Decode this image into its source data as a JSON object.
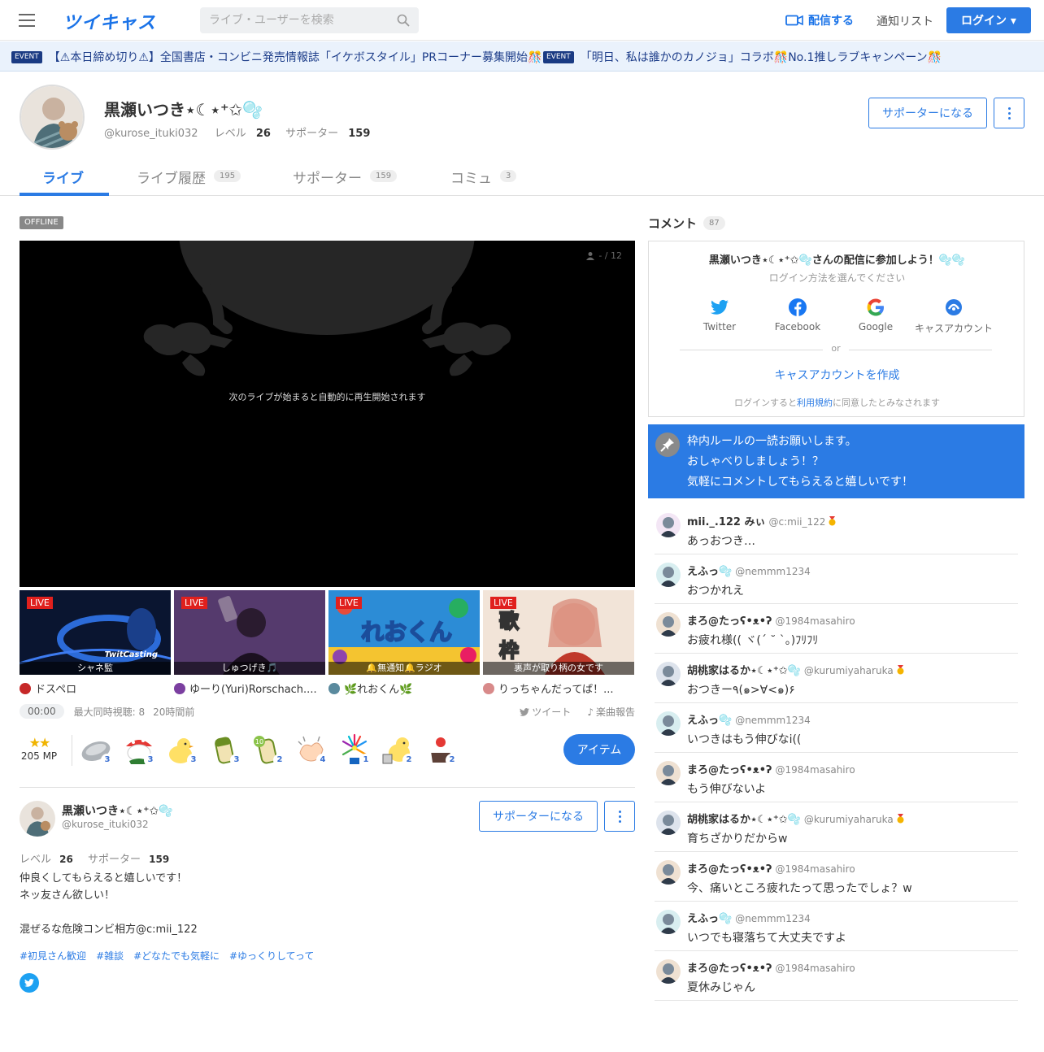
{
  "header": {
    "logo": "ツイキャス",
    "search_placeholder": "ライブ・ユーザーを検索",
    "stream_label": "配信する",
    "notif_label": "通知リスト",
    "login_label": "ログイン ▾"
  },
  "banner": {
    "events": [
      {
        "badge": "EVENT",
        "text": "【⚠本日締め切り⚠】全国書店・コンビニ発売情報誌「イケボスタイル」PRコーナー募集開始🎊"
      },
      {
        "badge": "EVENT",
        "text": "「明日、私は誰かのカノジョ」コラボ🎊No.1推しラブキャンペーン🎊"
      }
    ]
  },
  "profile": {
    "name": "黒瀬いつき⋆☾⋆⁺✩🫧",
    "handle": "@kurose_ituki032",
    "level_label": "レベル",
    "level": "26",
    "supporter_label": "サポーター",
    "supporters": "159",
    "support_button": "サポーターになる"
  },
  "tabs": [
    {
      "label": "ライブ",
      "count": ""
    },
    {
      "label": "ライブ履歴",
      "count": "195"
    },
    {
      "label": "サポーター",
      "count": "159"
    },
    {
      "label": "コミュ",
      "count": "3"
    }
  ],
  "player": {
    "status": "OFFLINE",
    "viewers": "- / 12",
    "autoplay_msg": "次のライブが始まると自動的に再生開始されます"
  },
  "recommended": [
    {
      "live": "LIVE",
      "caption": "シャネ監",
      "name": "ドスペロ",
      "thumb_text": "TwitCasting",
      "color": "#c62828"
    },
    {
      "live": "LIVE",
      "caption": "しゅつげき🎵",
      "name": "ゆーり(Yuri)Rorschach....",
      "thumb_text": "",
      "color": "#7b3fa0"
    },
    {
      "live": "LIVE",
      "caption": "🔔無通知🔔ラジオ",
      "name": "🌿れおくん🌿",
      "thumb_text": "れおくん",
      "color": "#5a8a9e"
    },
    {
      "live": "LIVE",
      "caption": "裏声が取り柄の女です",
      "name": "りっちゃんだってば！...",
      "thumb_text": "歌枠",
      "color": "#d88a8a"
    }
  ],
  "meta": {
    "time": "00:00",
    "max_viewers": "最大同時視聴: 8",
    "ago": "20時間前",
    "tweet": "ツイート",
    "song_report": "楽曲報告"
  },
  "items": {
    "stars": "★★",
    "mp": "205 MP",
    "counts": [
      "3",
      "3",
      "3",
      "3",
      "2",
      "4",
      "1",
      "2",
      "2"
    ],
    "button": "アイテム"
  },
  "bio": {
    "level_label": "レベル",
    "level": "26",
    "supporter_label": "サポーター",
    "supporters": "159",
    "text": "仲良くしてもらえると嬉しいです！\nネッ友さん欲しい！\n\n混ぜるな危険コンビ相方@c:mii_122",
    "tags": [
      "#初見さん歓迎",
      "#雑談",
      "#どなたでも気軽に",
      "#ゆっくりしてって"
    ]
  },
  "comments_panel": {
    "title": "コメント",
    "count": "87",
    "join_title": "黒瀬いつき⋆☾⋆⁺✩🫧さんの配信に参加しよう！🫧🫧",
    "join_sub": "ログイン方法を選んでください",
    "sns": [
      "Twitter",
      "Facebook",
      "Google",
      "キャスアカウント"
    ],
    "or": "or",
    "create": "キャスアカウントを作成",
    "terms_pre": "ログインすると",
    "terms_link": "利用規約",
    "terms_post": "に同意したとみなされます",
    "pinned": [
      "枠内ルールの一読お願いします。",
      "おしゃべりしましょう！？",
      "気軽にコメントしてもらえると嬉しいです！"
    ]
  },
  "comments": [
    {
      "name": "mii._.122 みぃ",
      "id": "@c:mii_122",
      "medal": true,
      "text": "あっおつき…"
    },
    {
      "name": "えふっ🫧",
      "id": "@nemmm1234",
      "medal": false,
      "text": "おつかれえ"
    },
    {
      "name": "まろ@たっʕ•ᴥ•ʔ",
      "id": "@1984masahiro",
      "medal": false,
      "text": "お疲れ様(( ヾ(´ ˘ `。)ﾌﾘﾌﾘ"
    },
    {
      "name": "胡桃家はるか⋆☾⋆⁺✩🫧",
      "id": "@kurumiyaharuka",
      "medal": true,
      "text": "おつきー٩(๑>∀<๑)۶"
    },
    {
      "name": "えふっ🫧",
      "id": "@nemmm1234",
      "medal": false,
      "text": "いつきはもう伸びなi(("
    },
    {
      "name": "まろ@たっʕ•ᴥ•ʔ",
      "id": "@1984masahiro",
      "medal": false,
      "text": "もう伸びないよ"
    },
    {
      "name": "胡桃家はるか⋆☾⋆⁺✩🫧",
      "id": "@kurumiyaharuka",
      "medal": true,
      "text": "育ちざかりだからw"
    },
    {
      "name": "まろ@たっʕ•ᴥ•ʔ",
      "id": "@1984masahiro",
      "medal": false,
      "text": "今、痛いところ疲れたって思ったでしょ？w"
    },
    {
      "name": "えふっ🫧",
      "id": "@nemmm1234",
      "medal": false,
      "text": "いつでも寝落ちて大丈夫ですよ"
    },
    {
      "name": "まろ@たっʕ•ᴥ•ʔ",
      "id": "@1984masahiro",
      "medal": false,
      "text": "夏休みじゃん"
    }
  ],
  "colors": {
    "accent": "#2b7be4",
    "live": "#e0201d",
    "banner_bg": "#eaf2fc"
  }
}
